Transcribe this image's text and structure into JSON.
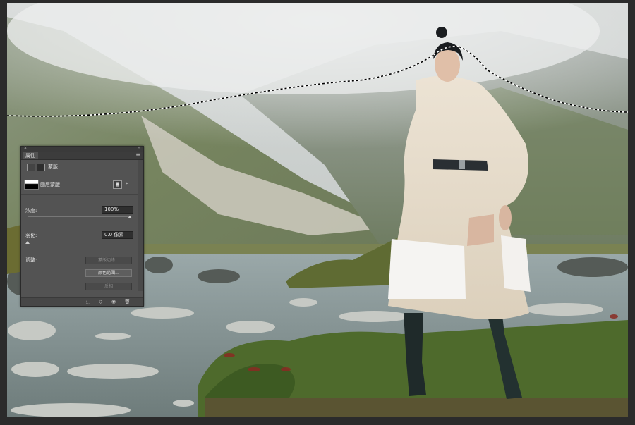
{
  "panel": {
    "close_glyph": "×",
    "collapse_glyph": "»",
    "tab_label": "属性",
    "menu_glyph": "≡",
    "type_label": "蒙版",
    "mask_label": "图层蒙版",
    "density_label": "浓度:",
    "density_value": "100%",
    "density_level": 1.0,
    "feather_label": "羽化:",
    "feather_value": "0.0 像素",
    "feather_level": 0.0,
    "adjust_label": "调整:",
    "buttons": {
      "mask_edge": "蒙版边缘...",
      "color_range": "颜色范围...",
      "invert": "反相"
    },
    "icons": {
      "brush_mask": "pixel-mask-icon",
      "vector_mask": "vector-mask-icon",
      "add_mask": "add-pixel-mask-icon",
      "add_vector": "add-vector-mask-icon",
      "load_selection": "load-selection-icon",
      "apply_mask": "apply-mask-icon",
      "toggle_visibility": "eye-icon",
      "delete": "trash-icon"
    },
    "bottom_glyphs": [
      "⬚",
      "◇",
      "◉",
      "🗑"
    ]
  },
  "colors": {
    "panel_bg": "#535353",
    "workspace_bg": "#2b2b2b"
  }
}
